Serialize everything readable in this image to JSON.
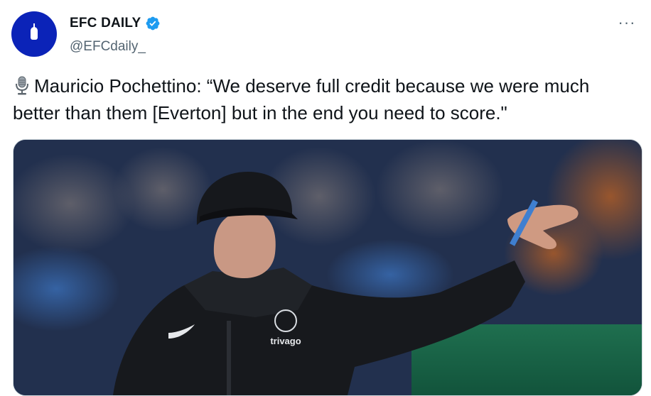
{
  "tweet": {
    "author": {
      "display_name": "EFC DAILY",
      "handle": "@EFCdaily_",
      "verified": true,
      "avatar_color": "#0b23b8"
    },
    "more_label": "···",
    "icon": "studio-microphone-icon",
    "text": "Mauricio Pochettino: “We deserve full credit because we were much better than them [Everton] but in the end you need to score.\"",
    "media": {
      "kind": "photo",
      "shirt_text": "trivago"
    }
  },
  "colors": {
    "verified_badge": "#1d9bf0",
    "secondary_text": "#536471",
    "primary_text": "#0f1419"
  }
}
